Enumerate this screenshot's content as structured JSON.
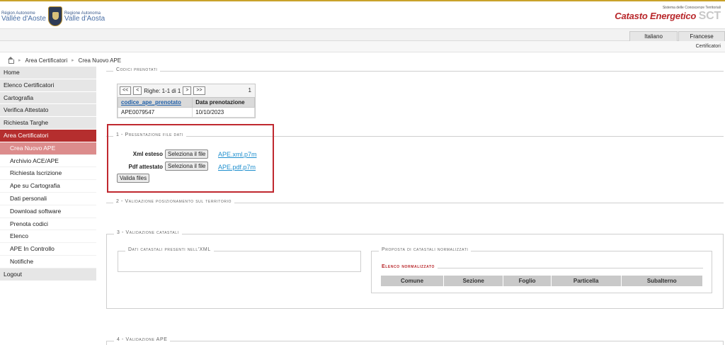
{
  "header": {
    "logo_left": {
      "title_a_small": "Région Autonome",
      "title_a_big": "Vallée d'Aoste",
      "title_b_small": "Regione Autonoma",
      "title_b_big": "Valle d'Aosta"
    },
    "logo_right": {
      "subtitle": "Sistema delle Conoscenze Territoriali",
      "brand": "Catasto Energetico",
      "sct": "SCT"
    }
  },
  "languages": [
    "Italiano",
    "Francese"
  ],
  "certificatori_label": "Certificatori",
  "breadcrumb": [
    "Area Certificatori",
    "Crea Nuovo APE"
  ],
  "sidebar": {
    "items": [
      {
        "label": "Home"
      },
      {
        "label": "Elenco Certificatori"
      },
      {
        "label": "Cartografia"
      },
      {
        "label": "Verifica Attestato"
      },
      {
        "label": "Richiesta Targhe"
      },
      {
        "label": "Area Certificatori"
      }
    ],
    "sub_items": [
      {
        "label": "Crea Nuovo APE"
      },
      {
        "label": "Archivio ACE/APE"
      },
      {
        "label": "Richiesta Iscrizione"
      },
      {
        "label": "Ape su Cartografia"
      },
      {
        "label": "Dati personali"
      },
      {
        "label": "Download software"
      },
      {
        "label": "Prenota codici"
      },
      {
        "label": "Elenco"
      },
      {
        "label": "APE In Controllo"
      },
      {
        "label": "Notifiche"
      }
    ],
    "logout": "Logout"
  },
  "codici": {
    "legend": "Codici prenotati",
    "pager": {
      "first": "<<",
      "prev": "<",
      "info": "Righe: 1-1 di 1",
      "next": ">",
      "last": ">>",
      "count": "1"
    },
    "columns": [
      "codice_ape_prenotato",
      "Data prenotazione"
    ],
    "rows": [
      [
        "APE0079547",
        "10/10/2023"
      ]
    ]
  },
  "section1": {
    "legend": "1 - Presentazione file dati",
    "xml_label": "Xml esteso",
    "pdf_label": "Pdf attestato",
    "select_file": "Seleziona il file",
    "xml_file": "APE.xml.p7m",
    "pdf_file": "APE.pdf.p7m",
    "validate": "Valida files"
  },
  "section2": {
    "legend": "2 - Validazione posizionamento sul territorio"
  },
  "section3": {
    "legend": "3 - Validazione catastali",
    "left_legend": "Dati catastali presenti nell'XML",
    "right_legend": "Proposta di catastali normalizzati",
    "inner_legend": "Elenco normalizzato",
    "columns": [
      "Comune",
      "Sezione",
      "Foglio",
      "Particella",
      "Subalterno"
    ]
  },
  "section4": {
    "legend": "4 - Validazione APE"
  },
  "colors": {
    "accent_red": "#b52e2e",
    "current_sub": "#dc8c8c",
    "link_blue": "#1f8fce",
    "highlight_box": "#c0282f"
  }
}
